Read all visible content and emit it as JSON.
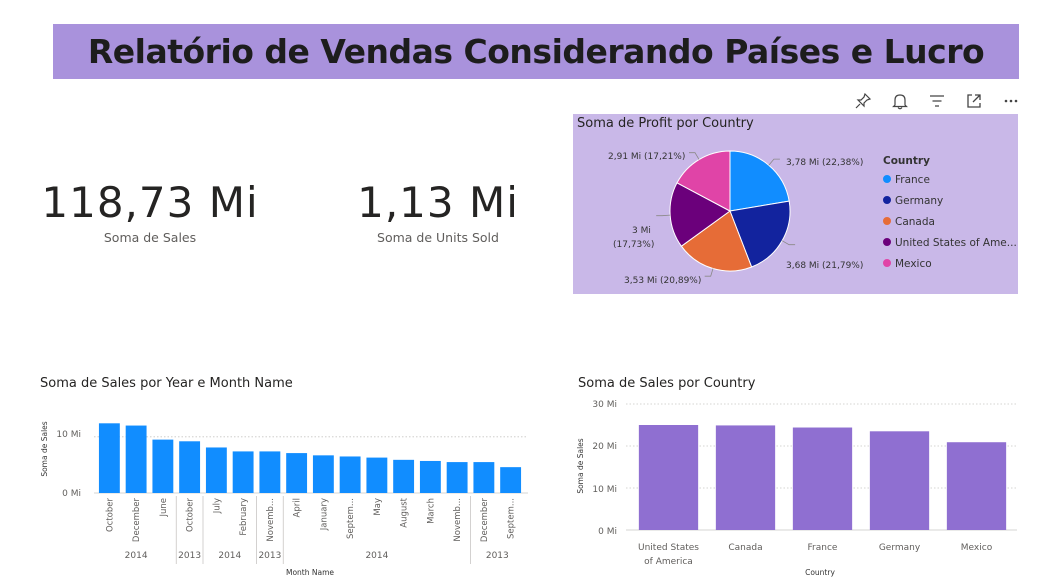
{
  "title": "Relatório de Vendas Considerando Países e Lucro",
  "toolbar": {
    "icons": [
      "pin-icon",
      "bell-icon",
      "filter-icon",
      "focus-mode-icon",
      "more-options-icon"
    ]
  },
  "kpis": [
    {
      "value": "118,73 Mi",
      "label": "Soma de  Sales"
    },
    {
      "value": "1,13 Mi",
      "label": "Soma de Units Sold"
    }
  ],
  "pie_chart": {
    "title": "Soma de Profit por Country",
    "legend_title": "Country",
    "colors": {
      "France": "#118dff",
      "Germany": "#12239e",
      "Canada": "#e66c37",
      "United States of America": "#6b007b",
      "Mexico": "#e044a7"
    },
    "slice_labels": [
      "3,78 Mi (22,38%)",
      "3,68 Mi (21,79%)",
      "3,53 Mi (20,89%)",
      "3 Mi",
      "(17,73%)",
      "2,91 Mi (17,21%)"
    ],
    "legend_labels": [
      "France",
      "Germany",
      "Canada",
      "United States of Ame...",
      "Mexico"
    ]
  },
  "monthly_chart": {
    "title": "Soma de Sales por Year e Month Name",
    "ylabel": "Soma de Sales",
    "xlabel": "Month Name",
    "ytick_labels": [
      "10 Mi",
      "0 Mi"
    ],
    "bar_color": "#118dff",
    "year_labels": [
      "2014",
      "2013",
      "2014",
      "2013",
      "2014",
      "2013"
    ]
  },
  "country_chart": {
    "title": "Soma de Sales por Country",
    "ylabel": "Soma de Sales",
    "xlabel": "Country",
    "ytick_labels": [
      "30 Mi",
      "20 Mi",
      "10 Mi",
      "0 Mi"
    ],
    "bar_color": "#8f6fd1"
  },
  "chart_data": [
    {
      "type": "pie",
      "title": "Soma de Profit por Country",
      "legend_title": "Country",
      "categories": [
        "France",
        "Germany",
        "Canada",
        "United States of America",
        "Mexico"
      ],
      "values": [
        3.78,
        3.68,
        3.53,
        3.0,
        2.91
      ],
      "percentages": [
        22.38,
        21.79,
        20.89,
        17.73,
        17.21
      ],
      "unit": "Mi",
      "legend": "right"
    },
    {
      "type": "bar",
      "title": "Soma de Sales por Year e Month Name",
      "xlabel": "Month Name",
      "ylabel": "Soma de Sales",
      "categories": [
        "October",
        "December",
        "June",
        "October",
        "July",
        "February",
        "Novemb...",
        "April",
        "January",
        "Septem...",
        "May",
        "August",
        "March",
        "Novemb...",
        "December",
        "Septem..."
      ],
      "years": [
        "2014",
        "2014",
        "2014",
        "2013",
        "2014",
        "2014",
        "2013",
        "2014",
        "2014",
        "2014",
        "2014",
        "2014",
        "2014",
        "2014",
        "2013",
        "2013"
      ],
      "values": [
        12.4,
        12.0,
        9.5,
        9.2,
        8.1,
        7.4,
        7.4,
        7.1,
        6.7,
        6.5,
        6.3,
        5.9,
        5.7,
        5.5,
        5.5,
        4.6
      ],
      "unit": "Mi",
      "ylim": [
        0,
        13.7
      ],
      "grid": true
    },
    {
      "type": "bar",
      "title": "Soma de Sales por Country",
      "xlabel": "Country",
      "ylabel": "Soma de Sales",
      "categories": [
        "United States of America",
        "Canada",
        "France",
        "Germany",
        "Mexico"
      ],
      "values": [
        25.0,
        24.9,
        24.4,
        23.5,
        20.9
      ],
      "unit": "Mi",
      "ylim": [
        0,
        30
      ],
      "grid": true
    }
  ]
}
